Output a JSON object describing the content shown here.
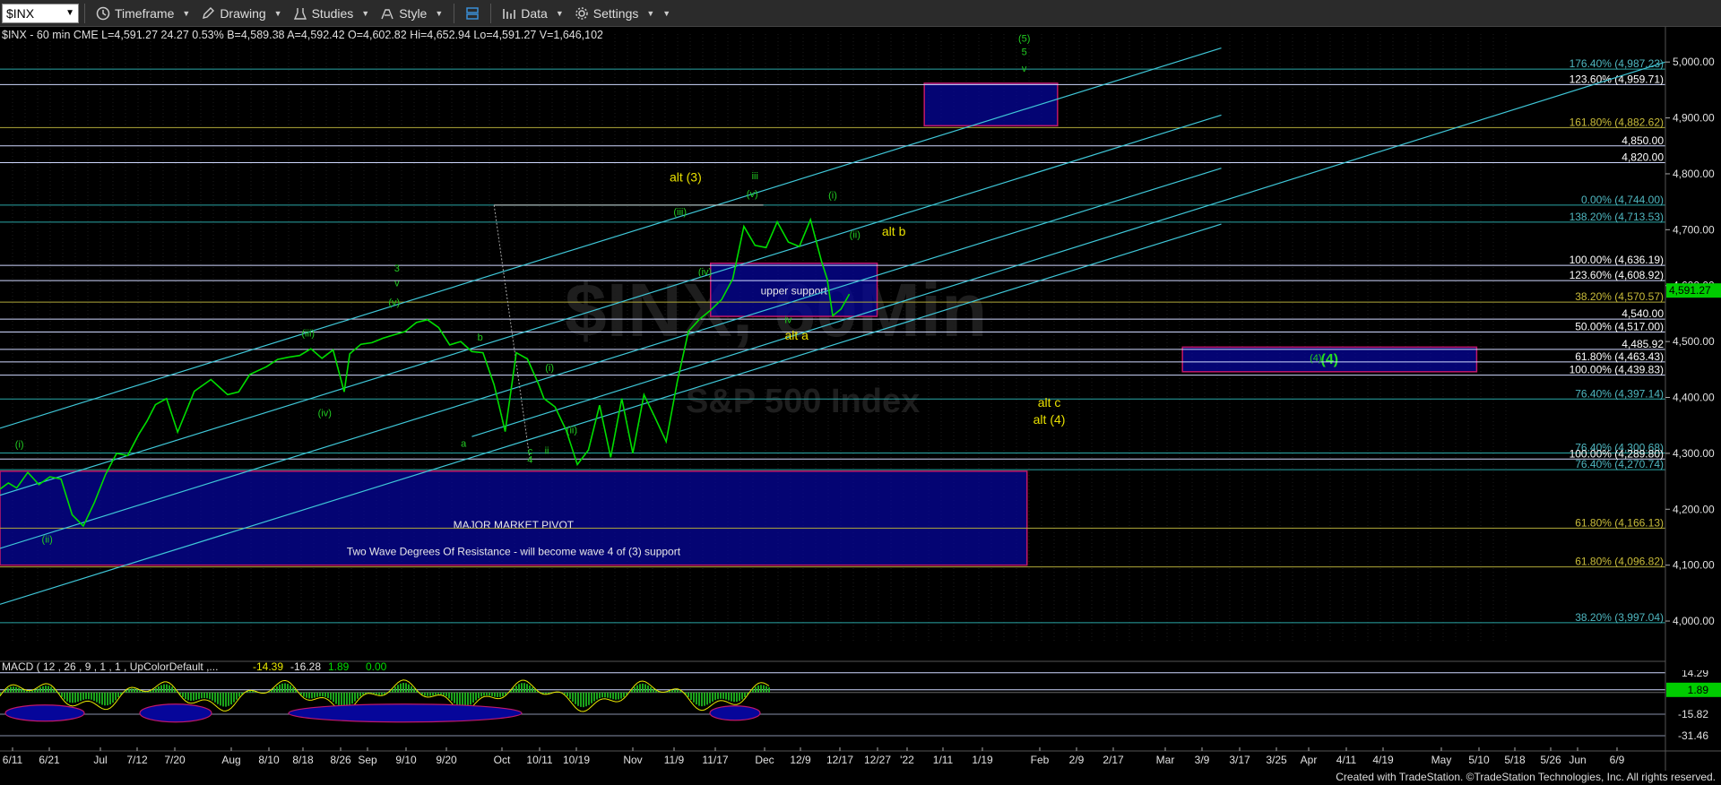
{
  "toolbar": {
    "symbol": "$INX",
    "timeframe_label": "Timeframe",
    "drawing_label": "Drawing",
    "studies_label": "Studies",
    "style_label": "Style",
    "data_label": "Data",
    "settings_label": "Settings"
  },
  "header_line": "$INX - 60 min  CME   L=4,591.27  24.27  0.53%  B=4,589.38  A=4,592.42  O=4,602.82  Hi=4,652.94  Lo=4,591.27  V=1,646,102",
  "watermark": {
    "main": "$INX, 60Min",
    "sub": "S&P 500 Index"
  },
  "footer": "Created with TradeStation. ©TradeStation Technologies, Inc. All rights reserved.",
  "colors": {
    "price": "#00dd00",
    "channel": "#3fc7d8",
    "fib_teal": "#2aa7a7",
    "fib_olive": "#b1a83a",
    "zone_fill": "#06069a",
    "zone_border": "#c0186a",
    "label_yellow": "#e8e000",
    "label_green": "#22cc22"
  },
  "chart_data": {
    "type": "line",
    "title": "",
    "ylim": [
      3960,
      5050
    ],
    "y_ticks": [
      4000,
      4100,
      4200,
      4300,
      4400,
      4500,
      4600,
      4700,
      4800,
      4900,
      5000
    ],
    "y_tick_labels": [
      "4,000.00",
      "4,100.00",
      "4,200.00",
      "4,300.00",
      "4,400.00",
      "4,500.00",
      "4,600.00",
      "4,700.00",
      "4,800.00",
      "4,900.00",
      "5,000.00"
    ],
    "x_tick_labels": [
      "6/11",
      "6/21",
      "Jul",
      "7/12",
      "7/20",
      "Aug",
      "8/10",
      "8/18",
      "8/26",
      "Sep",
      "9/10",
      "9/20",
      "Oct",
      "10/11",
      "10/19",
      "Nov",
      "11/9",
      "11/17",
      "Dec",
      "12/9",
      "12/17",
      "12/27",
      "'22",
      "1/11",
      "1/19",
      "Feb",
      "2/9",
      "2/17",
      "Mar",
      "3/9",
      "3/17",
      "3/25",
      "Apr",
      "4/11",
      "4/19",
      "May",
      "5/10",
      "5/18",
      "5/26",
      "Jun",
      "6/9"
    ],
    "series": [
      {
        "x": [
          0,
          3,
          6,
          10,
          14,
          18,
          22,
          26,
          30,
          34,
          38,
          42,
          46,
          50,
          53,
          56,
          60,
          64,
          70,
          76,
          82,
          86,
          90,
          96,
          100,
          104,
          108,
          112,
          116,
          120,
          124,
          126,
          130,
          134,
          138,
          142,
          146,
          150,
          154,
          158,
          162,
          166,
          170,
          174,
          178,
          182,
          186,
          190,
          194,
          196,
          200,
          204,
          208,
          212,
          216,
          220,
          224,
          228,
          232,
          236,
          240,
          244,
          248,
          252,
          256,
          260,
          264,
          268,
          272,
          276,
          280,
          284,
          288,
          292,
          296,
          298,
          300,
          303,
          306
        ],
        "values": [
          4236,
          4247,
          4238,
          4266,
          4244,
          4258,
          4254,
          4190,
          4170,
          4212,
          4262,
          4300,
          4296,
          4334,
          4358,
          4387,
          4398,
          4338,
          4411,
          4432,
          4405,
          4410,
          4441,
          4455,
          4468,
          4472,
          4475,
          4487,
          4470,
          4485,
          4410,
          4478,
          4495,
          4498,
          4506,
          4512,
          4518,
          4534,
          4539,
          4525,
          4494,
          4500,
          4482,
          4480,
          4423,
          4339,
          4480,
          4469,
          4424,
          4398,
          4383,
          4341,
          4280,
          4306,
          4386,
          4293,
          4398,
          4300,
          4405,
          4364,
          4321,
          4428,
          4518,
          4540,
          4556,
          4575,
          4612,
          4706,
          4672,
          4668,
          4714,
          4678,
          4670,
          4718,
          4643,
          4612,
          4546,
          4558,
          4585
        ]
      }
    ],
    "fib_levels": [
      {
        "value": 4987.23,
        "label": "176.40% (4,987.23)"
      },
      {
        "value": 4959.71,
        "label": "123.60% (4,959.71)"
      },
      {
        "value": 4882.62,
        "label": "161.80% (4,882.62)"
      },
      {
        "value": 4850.0,
        "label": "4,850.00"
      },
      {
        "value": 4820.0,
        "label": "4,820.00"
      },
      {
        "value": 4744.0,
        "label": "0.00% (4,744.00)"
      },
      {
        "value": 4713.53,
        "label": "138.20% (4,713.53)"
      },
      {
        "value": 4636.19,
        "label": "100.00% (4,636.19)"
      },
      {
        "value": 4608.92,
        "label": "123.60% (4,608.92)"
      },
      {
        "value": 4570.57,
        "label": "38.20% (4,570.57)"
      },
      {
        "value": 4540.0,
        "label": "4,540.00"
      },
      {
        "value": 4517.0,
        "label": "50.00% (4,517.00)"
      },
      {
        "value": 4485.92,
        "label": "4,485.92"
      },
      {
        "value": 4463.43,
        "label": "61.80% (4,463.43)"
      },
      {
        "value": 4439.83,
        "label": "100.00% (4,439.83)"
      },
      {
        "value": 4397.14,
        "label": "76.40% (4,397.14)"
      },
      {
        "value": 4300.68,
        "label": "76.40% (4,300.68)"
      },
      {
        "value": 4289.8,
        "label": "100.00% (4,289.80)"
      },
      {
        "value": 4270.74,
        "label": "76.40% (4,270.74)"
      },
      {
        "value": 4166.13,
        "label": "61.80% (4,166.13)"
      },
      {
        "value": 4096.82,
        "label": "61.80% (4,096.82)"
      },
      {
        "value": 3997.04,
        "label": "38.20% (3,997.04)"
      }
    ],
    "last_price": {
      "value": 4591.27,
      "label": "4,591.27"
    },
    "zones": [
      {
        "x": [
          0,
          370
        ],
        "y": [
          4100,
          4268
        ],
        "labels": [
          "MAJOR MARKET PIVOT",
          "Two Wave Degrees Of Resistance - will become wave 4 of (3) support"
        ]
      },
      {
        "x": [
          256,
          316
        ],
        "y": [
          4545,
          4640
        ],
        "labels": [
          "upper support"
        ]
      },
      {
        "x": [
          426,
          532
        ],
        "y": [
          4446,
          4490
        ],
        "labels": [
          "(4)"
        ]
      },
      {
        "x": [
          333,
          381
        ],
        "y": [
          4886,
          4962
        ],
        "labels": []
      }
    ],
    "wave_labels": [
      {
        "text": "alt (3)",
        "x": 247,
        "y": 4786,
        "color": "yellow"
      },
      {
        "text": "iii",
        "x": 272,
        "y": 4790,
        "color": "green"
      },
      {
        "text": "(iii)",
        "x": 245,
        "y": 4726,
        "color": "green"
      },
      {
        "text": "(v)",
        "x": 271,
        "y": 4758,
        "color": "green"
      },
      {
        "text": "(iv)",
        "x": 254,
        "y": 4619,
        "color": "green"
      },
      {
        "text": "(i)",
        "x": 300,
        "y": 4756,
        "color": "green"
      },
      {
        "text": "(ii)",
        "x": 308,
        "y": 4685,
        "color": "green"
      },
      {
        "text": "alt b",
        "x": 322,
        "y": 4689,
        "color": "yellow"
      },
      {
        "text": "iv",
        "x": 284,
        "y": 4533,
        "color": "green"
      },
      {
        "text": "alt a",
        "x": 287,
        "y": 4503,
        "color": "yellow"
      },
      {
        "text": "(4)",
        "x": 474,
        "y": 4465,
        "color": "green"
      },
      {
        "text": "alt c",
        "x": 378,
        "y": 4383,
        "color": "yellow"
      },
      {
        "text": "alt (4)",
        "x": 378,
        "y": 4353,
        "color": "yellow"
      },
      {
        "text": "(5)",
        "x": 369,
        "y": 5036,
        "color": "green"
      },
      {
        "text": "5",
        "x": 369,
        "y": 5012,
        "color": "green"
      },
      {
        "text": "v",
        "x": 369,
        "y": 4983,
        "color": "green"
      },
      {
        "text": "3",
        "x": 143,
        "y": 4625,
        "color": "green"
      },
      {
        "text": "v",
        "x": 143,
        "y": 4599,
        "color": "green"
      },
      {
        "text": "(v)",
        "x": 142,
        "y": 4564,
        "color": "green"
      },
      {
        "text": "(iii)",
        "x": 111,
        "y": 4509,
        "color": "green"
      },
      {
        "text": "(iv)",
        "x": 117,
        "y": 4366,
        "color": "green"
      },
      {
        "text": "b",
        "x": 173,
        "y": 4502,
        "color": "green"
      },
      {
        "text": "a",
        "x": 167,
        "y": 4312,
        "color": "green"
      },
      {
        "text": "c",
        "x": 191,
        "y": 4298,
        "color": "green"
      },
      {
        "text": "4",
        "x": 191,
        "y": 4283,
        "color": "green"
      },
      {
        "text": "ii",
        "x": 197,
        "y": 4299,
        "color": "green"
      },
      {
        "text": "(i)",
        "x": 198,
        "y": 4447,
        "color": "green"
      },
      {
        "text": "(ii)",
        "x": 206,
        "y": 4336,
        "color": "green"
      },
      {
        "text": "(i)",
        "x": 7,
        "y": 4310,
        "color": "green"
      },
      {
        "text": "(ii)",
        "x": 17,
        "y": 4140,
        "color": "green"
      }
    ],
    "macd": {
      "label": "MACD ( 12 , 26 , 9 , 1 , 1 , UpColorDefault ,...",
      "values": [
        "-14.39",
        "-16.28",
        "1.89",
        "0.00"
      ],
      "ylim": [
        -36,
        20
      ],
      "right_labels": [
        {
          "value": 14.29,
          "label": "14.29"
        },
        {
          "value": 1.89,
          "label": "1.89"
        },
        {
          "value": -15.82,
          "label": "-15.82"
        },
        {
          "value": -31.46,
          "label": "-31.46"
        }
      ]
    }
  }
}
